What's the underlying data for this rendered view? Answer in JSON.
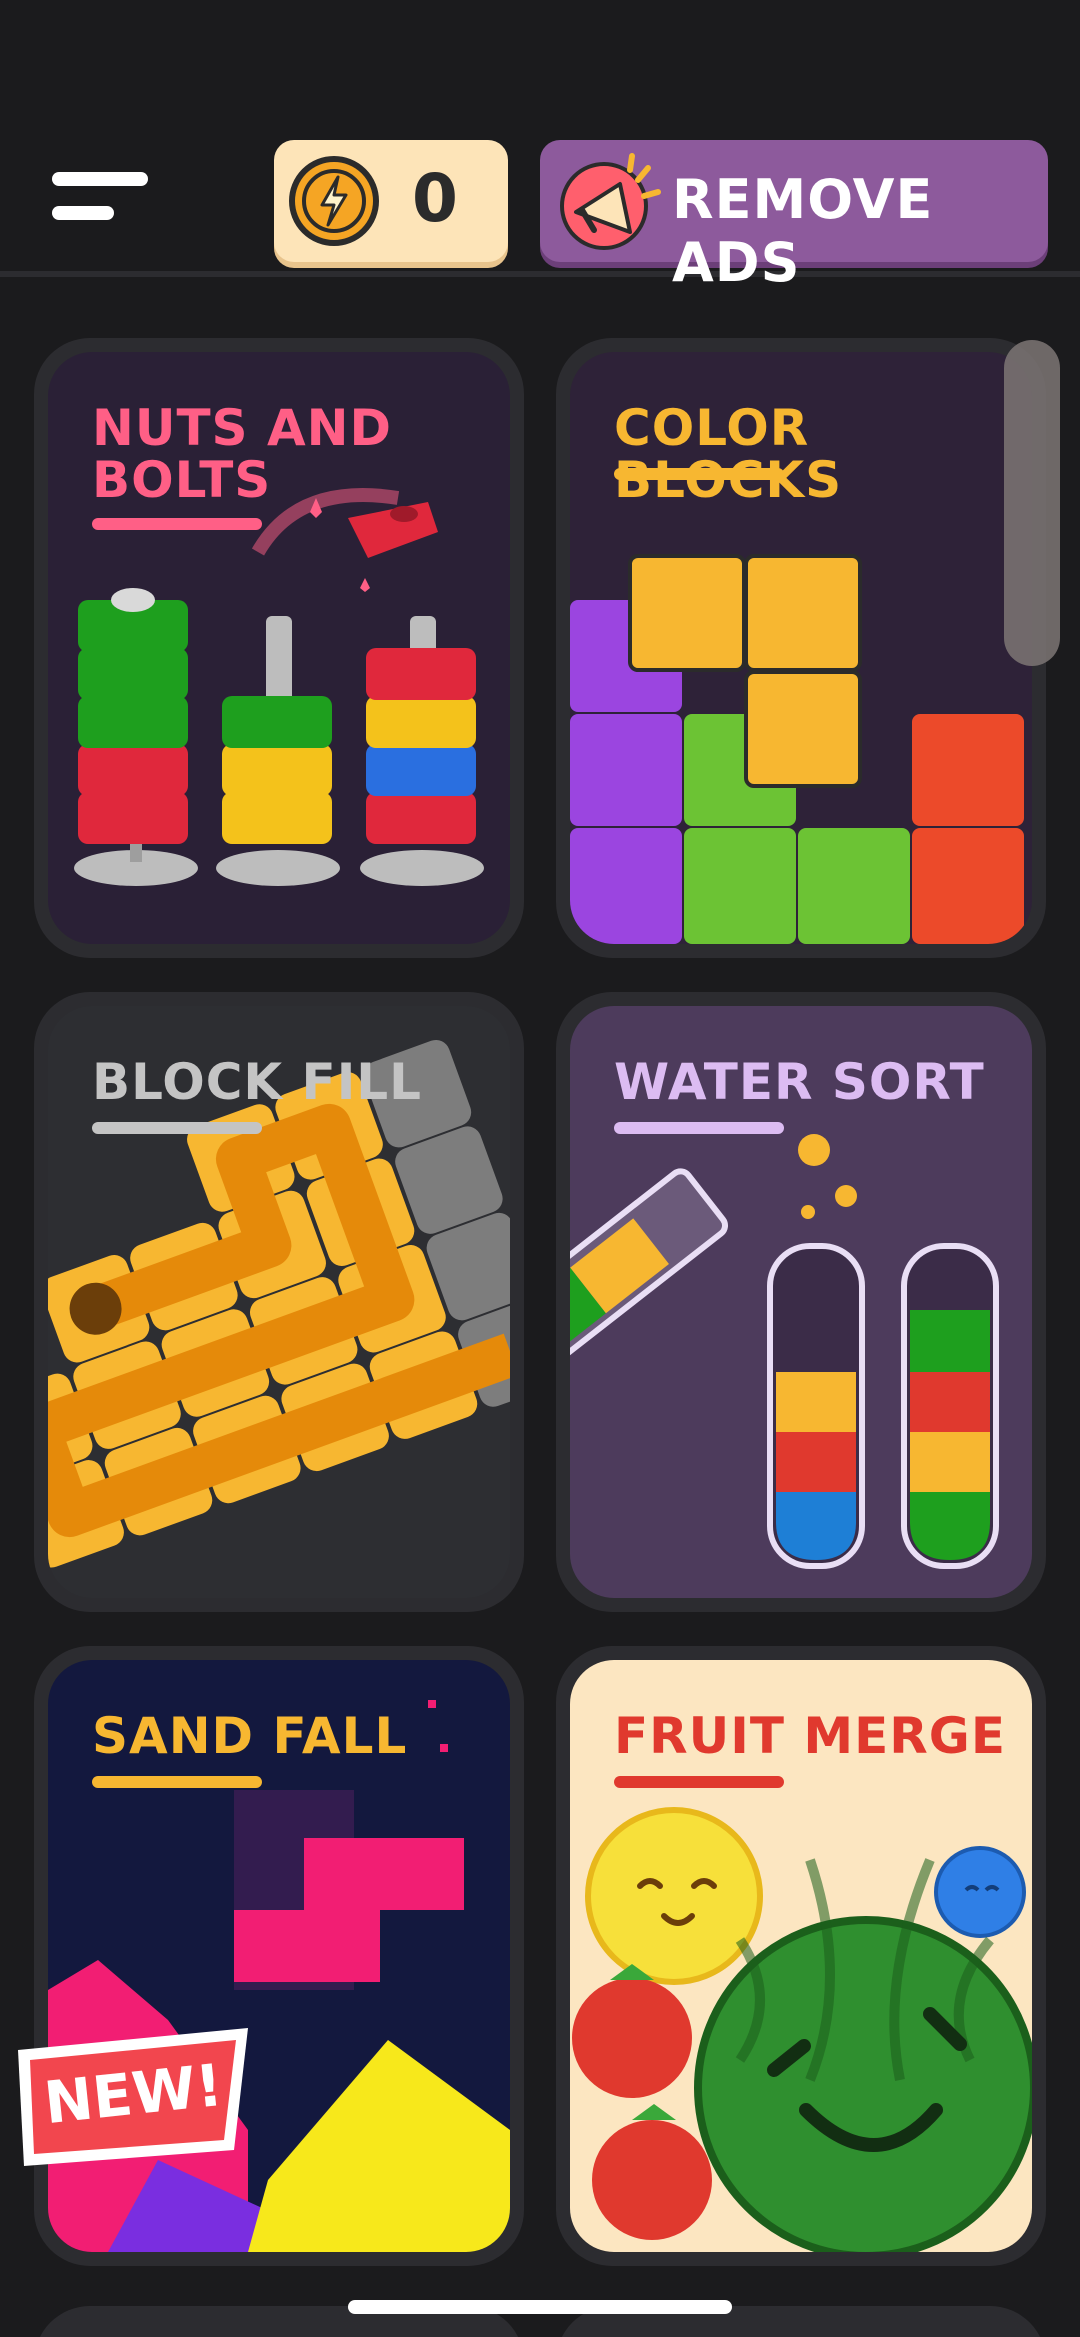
{
  "header": {
    "coins": "0",
    "remove_ads_label": "REMOVE ADS",
    "icons": {
      "menu": "hamburger-menu-icon",
      "coin": "lightning-coin-icon",
      "ads": "megaphone-icon"
    }
  },
  "games": [
    {
      "title": "NUTS AND BOLTS",
      "title_color": "#ff5f86",
      "bg": "#2a2036"
    },
    {
      "title": "COLOR BLOCKS",
      "title_color": "#f7b731",
      "bg": "#2e2238"
    },
    {
      "title": "BLOCK FILL",
      "title_color": "#c4c4c4",
      "bg": "#2d2e32"
    },
    {
      "title": "WATER SORT",
      "title_color": "#dcbcf2",
      "bg": "#4d3b5c"
    },
    {
      "title": "SAND FALL",
      "title_color": "#f7b731",
      "bg": "#13183e"
    },
    {
      "title": "FRUIT MERGE",
      "title_color": "#e0392e",
      "bg": "#fce6c1"
    }
  ],
  "badges": {
    "new": "NEW!"
  }
}
